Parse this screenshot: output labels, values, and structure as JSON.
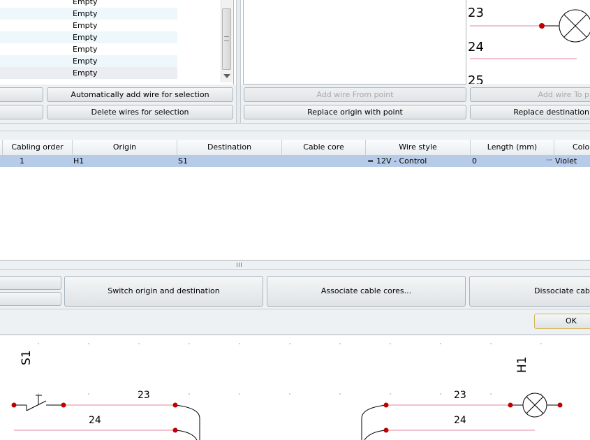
{
  "wire_list": {
    "items": [
      "Empty",
      "Empty",
      "Empty",
      "Empty",
      "Empty",
      "Empty",
      "Empty"
    ]
  },
  "buttons": {
    "auto_add_wire": "Automatically add wire for selection",
    "delete_wires": "Delete wires for selection",
    "add_wire_from_point": "Add wire From point",
    "replace_origin": "Replace origin with point",
    "add_wire_to_point": "Add wire To p",
    "replace_destination": "Replace destination",
    "switch_origin_destination": "Switch origin and destination",
    "associate_cable_cores": "Associate cable cores...",
    "dissociate_cable": "Dissociate cable c",
    "ok": "OK"
  },
  "preview_top": {
    "terminals": [
      "23",
      "24",
      "25"
    ]
  },
  "table": {
    "columns": [
      "Cabling order",
      "Origin",
      "Destination",
      "Cable core",
      "Wire style",
      "Length (mm)",
      "Color"
    ],
    "rows": [
      {
        "cabling_order": "1",
        "origin": "H1",
        "destination": "S1",
        "cable_core": "",
        "wire_style_prefix": "=",
        "wire_style": "12V - Control",
        "length": "0",
        "color_prefix": "···",
        "color": "Violet"
      }
    ]
  },
  "schematic": {
    "left_label": "S1",
    "right_label": "H1",
    "left_wires": [
      "23",
      "24"
    ],
    "right_wires": [
      "23",
      "24"
    ]
  },
  "colors": {
    "selected_row": "#b6cbe8",
    "wire": "#e0869e",
    "node": "#c00000"
  }
}
